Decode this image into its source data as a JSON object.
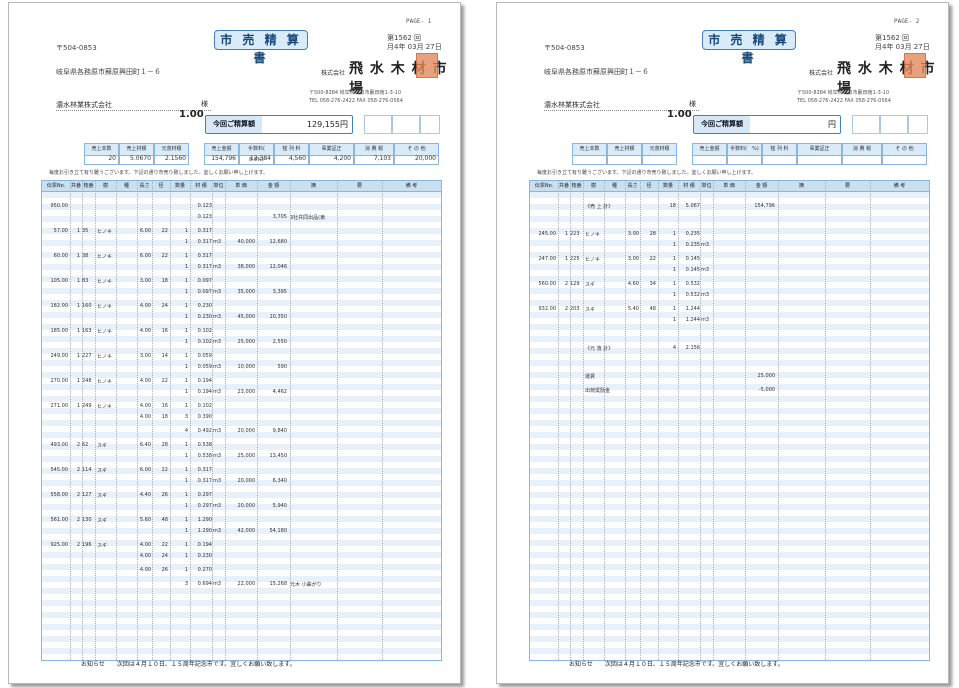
{
  "pages": [
    {
      "page_label": "PAGE- 1",
      "title": "市 売 精 算 書",
      "issue_no": "第1562 回",
      "issue_date": "月4年 03月 27日",
      "postal": "〒504-0853",
      "address": "岐阜県各務原市蘇原興田町１－６",
      "customer": "濃水林業株式会社",
      "honorific": "様",
      "big_number": "1.00",
      "company_prefix": "株式会社",
      "company_name": "飛 水 木 材 市 場",
      "company_addr1": "〒500-8384 岐阜県岐阜市藪田南1-3-10",
      "company_addr2": "TEL 058-276-2422   FAX 058-276-0564",
      "payment_label": "今回ご精算額",
      "payment_value": "129,155円",
      "summary_headers": [
        "売上本数",
        "売上材積",
        "元落材積",
        "売上金額",
        "手数料(　8.0%)",
        "椪 列 料",
        "事業証正",
        "消 費 税",
        "そ の 他"
      ],
      "summary_values": [
        "20",
        "5.0670",
        "2.1560",
        "154,796",
        "12,384",
        "4,560",
        "4,200",
        "7,103",
        "20,000"
      ],
      "notice": "毎度お引き立て有り難うございます。下記の通り市売り致しました。宜しくお願い申し上げます。",
      "table_headers": [
        "伝票No.",
        "共番",
        "枝番",
        "樹",
        "種",
        "長さ",
        "径",
        "数量",
        "材 積",
        "単位",
        "単 価",
        "金 額",
        "摘",
        "要",
        "備 考"
      ],
      "rows": [
        {
          "a": "950.00",
          "b": "",
          "c": "",
          "d": "",
          "e": "",
          "f": "",
          "g": "",
          "h": "",
          "i": "0.123",
          "j": "",
          "k": "",
          "l": "",
          "m": ""
        },
        {
          "a": "",
          "b": "",
          "c": "",
          "d": "",
          "e": "",
          "f": "",
          "g": "",
          "h": "",
          "i": "0.123",
          "j": "",
          "k": "",
          "l": "3,705",
          "m": "3社共同出品(東"
        },
        {
          "a": "57.00",
          "b": "1",
          "c": "35",
          "d": "ヒノキ",
          "e": "6.00",
          "f": "22",
          "g": "1",
          "h": "",
          "i": "0.317",
          "j": "",
          "k": "",
          "l": "",
          "m": ""
        },
        {
          "a": "",
          "b": "",
          "c": "",
          "d": "",
          "e": "",
          "f": "",
          "g": "1",
          "h": "",
          "i": "0.317",
          "j": "m3",
          "k": "40,000",
          "l": "12,680",
          "m": ""
        },
        {
          "a": "60.00",
          "b": "1",
          "c": "38",
          "d": "ヒノキ",
          "e": "6.00",
          "f": "22",
          "g": "1",
          "h": "",
          "i": "0.317",
          "j": "",
          "k": "",
          "l": "",
          "m": ""
        },
        {
          "a": "",
          "b": "",
          "c": "",
          "d": "",
          "e": "",
          "f": "",
          "g": "1",
          "h": "",
          "i": "0.317",
          "j": "m3",
          "k": "38,000",
          "l": "12,046",
          "m": ""
        },
        {
          "a": "105.00",
          "b": "1",
          "c": "83",
          "d": "ヒノキ",
          "e": "3.00",
          "f": "18",
          "g": "1",
          "h": "",
          "i": "0.097",
          "j": "",
          "k": "",
          "l": "",
          "m": ""
        },
        {
          "a": "",
          "b": "",
          "c": "",
          "d": "",
          "e": "",
          "f": "",
          "g": "1",
          "h": "",
          "i": "0.097",
          "j": "m3",
          "k": "35,000",
          "l": "3,395",
          "m": ""
        },
        {
          "a": "182.00",
          "b": "1",
          "c": "160",
          "d": "ヒノキ",
          "e": "4.00",
          "f": "24",
          "g": "1",
          "h": "",
          "i": "0.230",
          "j": "",
          "k": "",
          "l": "",
          "m": ""
        },
        {
          "a": "",
          "b": "",
          "c": "",
          "d": "",
          "e": "",
          "f": "",
          "g": "1",
          "h": "",
          "i": "0.230",
          "j": "m3",
          "k": "45,000",
          "l": "10,350",
          "m": ""
        },
        {
          "a": "185.00",
          "b": "1",
          "c": "163",
          "d": "ヒノキ",
          "e": "4.00",
          "f": "16",
          "g": "1",
          "h": "",
          "i": "0.102",
          "j": "",
          "k": "",
          "l": "",
          "m": ""
        },
        {
          "a": "",
          "b": "",
          "c": "",
          "d": "",
          "e": "",
          "f": "",
          "g": "1",
          "h": "",
          "i": "0.102",
          "j": "m3",
          "k": "25,000",
          "l": "2,550",
          "m": ""
        },
        {
          "a": "249.00",
          "b": "1",
          "c": "227",
          "d": "ヒノキ",
          "e": "3.00",
          "f": "14",
          "g": "1",
          "h": "",
          "i": "0.059",
          "j": "",
          "k": "",
          "l": "",
          "m": ""
        },
        {
          "a": "",
          "b": "",
          "c": "",
          "d": "",
          "e": "",
          "f": "",
          "g": "1",
          "h": "",
          "i": "0.059",
          "j": "m3",
          "k": "10,000",
          "l": "590",
          "m": ""
        },
        {
          "a": "270.00",
          "b": "1",
          "c": "248",
          "d": "ヒノキ",
          "e": "4.00",
          "f": "22",
          "g": "1",
          "h": "",
          "i": "0.194",
          "j": "",
          "k": "",
          "l": "",
          "m": ""
        },
        {
          "a": "",
          "b": "",
          "c": "",
          "d": "",
          "e": "",
          "f": "",
          "g": "1",
          "h": "",
          "i": "0.194",
          "j": "m3",
          "k": "23,000",
          "l": "4,462",
          "m": ""
        },
        {
          "a": "271.00",
          "b": "1",
          "c": "249",
          "d": "ヒノキ",
          "e": "4.00",
          "f": "16",
          "g": "1",
          "h": "",
          "i": "0.102",
          "j": "",
          "k": "",
          "l": "",
          "m": ""
        },
        {
          "a": "",
          "b": "",
          "c": "",
          "d": "",
          "e": "4.00",
          "f": "18",
          "g": "3",
          "h": "",
          "i": "0.390",
          "j": "",
          "k": "",
          "l": "",
          "m": ""
        },
        {
          "a": "",
          "b": "",
          "c": "",
          "d": "",
          "e": "",
          "f": "",
          "g": "4",
          "h": "",
          "i": "0.492",
          "j": "m3",
          "k": "20,000",
          "l": "9,840",
          "m": ""
        },
        {
          "a": "493.00",
          "b": "2",
          "c": "62",
          "d": "スギ",
          "e": "6.40",
          "f": "28",
          "g": "1",
          "h": "",
          "i": "0.538",
          "j": "",
          "k": "",
          "l": "",
          "m": ""
        },
        {
          "a": "",
          "b": "",
          "c": "",
          "d": "",
          "e": "",
          "f": "",
          "g": "1",
          "h": "",
          "i": "0.538",
          "j": "m3",
          "k": "25,000",
          "l": "13,450",
          "m": ""
        },
        {
          "a": "545.00",
          "b": "2",
          "c": "114",
          "d": "スギ",
          "e": "6.00",
          "f": "22",
          "g": "1",
          "h": "",
          "i": "0.317",
          "j": "",
          "k": "",
          "l": "",
          "m": ""
        },
        {
          "a": "",
          "b": "",
          "c": "",
          "d": "",
          "e": "",
          "f": "",
          "g": "1",
          "h": "",
          "i": "0.317",
          "j": "m3",
          "k": "20,000",
          "l": "6,340",
          "m": ""
        },
        {
          "a": "558.00",
          "b": "2",
          "c": "127",
          "d": "スギ",
          "e": "4.40",
          "f": "26",
          "g": "1",
          "h": "",
          "i": "0.297",
          "j": "",
          "k": "",
          "l": "",
          "m": ""
        },
        {
          "a": "",
          "b": "",
          "c": "",
          "d": "",
          "e": "",
          "f": "",
          "g": "1",
          "h": "",
          "i": "0.297",
          "j": "m3",
          "k": "20,000",
          "l": "5,940",
          "m": ""
        },
        {
          "a": "561.00",
          "b": "2",
          "c": "130",
          "d": "スギ",
          "e": "5.60",
          "f": "48",
          "g": "1",
          "h": "",
          "i": "1.290",
          "j": "",
          "k": "",
          "l": "",
          "m": ""
        },
        {
          "a": "",
          "b": "",
          "c": "",
          "d": "",
          "e": "",
          "f": "",
          "g": "1",
          "h": "",
          "i": "1.290",
          "j": "m3",
          "k": "42,000",
          "l": "54,180",
          "m": ""
        },
        {
          "a": "925.00",
          "b": "2",
          "c": "196",
          "d": "スギ",
          "e": "4.00",
          "f": "22",
          "g": "1",
          "h": "",
          "i": "0.194",
          "j": "",
          "k": "",
          "l": "",
          "m": ""
        },
        {
          "a": "",
          "b": "",
          "c": "",
          "d": "",
          "e": "4.00",
          "f": "24",
          "g": "1",
          "h": "",
          "i": "0.230",
          "j": "",
          "k": "",
          "l": "",
          "m": ""
        },
        {
          "a": "",
          "b": "",
          "c": "",
          "d": "",
          "e": "4.00",
          "f": "26",
          "g": "1",
          "h": "",
          "i": "0.270",
          "j": "",
          "k": "",
          "l": "",
          "m": ""
        },
        {
          "a": "",
          "b": "",
          "c": "",
          "d": "",
          "e": "",
          "f": "",
          "g": "3",
          "h": "",
          "i": "0.694",
          "j": "m3",
          "k": "22,000",
          "l": "15,268",
          "m": "元木 小曲がり"
        }
      ],
      "footer": "お知らせ　　次回は４月１０日、１５周年記念市です。宜しくお願い致します。"
    },
    {
      "page_label": "PAGE- 2",
      "title": "市 売 精 算 書",
      "issue_no": "第1562 回",
      "issue_date": "月4年 03月 27日",
      "postal": "〒504-0853",
      "address": "岐阜県各務原市蘇原興田町１－６",
      "customer": "濃水林業株式会社",
      "honorific": "様",
      "big_number": "1.00",
      "company_prefix": "株式会社",
      "company_name": "飛 水 木 材 市 場",
      "company_addr1": "〒500-8384 岐阜県岐阜市藪田南1-3-10",
      "company_addr2": "TEL 058-276-2422   FAX 058-276-0564",
      "payment_label": "今回ご精算額",
      "payment_value": "円",
      "summary_headers": [
        "売上本数",
        "売上材積",
        "元落材積",
        "売上金額",
        "手数料(　%)",
        "椪 列 料",
        "事業証正",
        "消 費 税",
        "そ の 他"
      ],
      "summary_values": [
        "",
        "",
        "",
        "",
        "",
        "",
        "",
        "",
        ""
      ],
      "notice": "毎度お引き立て有り難うございます。下記の通り市売り致しました。宜しくお願い申し上げます。",
      "table_headers": [
        "伝票No.",
        "共番",
        "枝番",
        "樹",
        "種",
        "長さ",
        "径",
        "数量",
        "材 積",
        "単位",
        "単 価",
        "金 額",
        "摘",
        "要",
        "備 考"
      ],
      "rows": [
        {
          "a": "",
          "b": "",
          "c": "",
          "d": "《売 上 計》",
          "e": "",
          "f": "",
          "g": "18",
          "h": "",
          "i": "5.067",
          "j": "",
          "k": "",
          "l": "154,796",
          "m": ""
        },
        {
          "a": "",
          "b": "",
          "c": "",
          "d": "",
          "e": "",
          "f": "",
          "g": "",
          "h": "",
          "i": "",
          "j": "",
          "k": "",
          "l": "",
          "m": ""
        },
        {
          "a": "245.00",
          "b": "1",
          "c": "223",
          "d": "ヒノキ",
          "e": "3.00",
          "f": "28",
          "g": "1",
          "h": "",
          "i": "0.235",
          "j": "",
          "k": "",
          "l": "",
          "m": ""
        },
        {
          "a": "",
          "b": "",
          "c": "",
          "d": "",
          "e": "",
          "f": "",
          "g": "1",
          "h": "",
          "i": "0.235",
          "j": "m3",
          "k": "",
          "l": "",
          "m": ""
        },
        {
          "a": "247.00",
          "b": "1",
          "c": "225",
          "d": "ヒノキ",
          "e": "3.00",
          "f": "22",
          "g": "1",
          "h": "",
          "i": "0.145",
          "j": "",
          "k": "",
          "l": "",
          "m": ""
        },
        {
          "a": "",
          "b": "",
          "c": "",
          "d": "",
          "e": "",
          "f": "",
          "g": "1",
          "h": "",
          "i": "0.145",
          "j": "m3",
          "k": "",
          "l": "",
          "m": ""
        },
        {
          "a": "560.00",
          "b": "2",
          "c": "129",
          "d": "スギ",
          "e": "4.60",
          "f": "34",
          "g": "1",
          "h": "",
          "i": "0.532",
          "j": "",
          "k": "",
          "l": "",
          "m": ""
        },
        {
          "a": "",
          "b": "",
          "c": "",
          "d": "",
          "e": "",
          "f": "",
          "g": "1",
          "h": "",
          "i": "0.532",
          "j": "m3",
          "k": "",
          "l": "",
          "m": ""
        },
        {
          "a": "932.00",
          "b": "2",
          "c": "203",
          "d": "スギ",
          "e": "5.40",
          "f": "48",
          "g": "1",
          "h": "",
          "i": "1.244",
          "j": "",
          "k": "",
          "l": "",
          "m": ""
        },
        {
          "a": "",
          "b": "",
          "c": "",
          "d": "",
          "e": "",
          "f": "",
          "g": "1",
          "h": "",
          "i": "1.244",
          "j": "m3",
          "k": "",
          "l": "",
          "m": ""
        },
        {
          "a": "",
          "b": "",
          "c": "",
          "d": "",
          "e": "",
          "f": "",
          "g": "",
          "h": "",
          "i": "",
          "j": "",
          "k": "",
          "l": "",
          "m": ""
        },
        {
          "a": "",
          "b": "",
          "c": "",
          "d": "《元 落 計》",
          "e": "",
          "f": "",
          "g": "4",
          "h": "",
          "i": "2.156",
          "j": "",
          "k": "",
          "l": "",
          "m": ""
        },
        {
          "a": "",
          "b": "",
          "c": "",
          "d": "",
          "e": "",
          "f": "",
          "g": "",
          "h": "",
          "i": "",
          "j": "",
          "k": "",
          "l": "",
          "m": ""
        },
        {
          "a": "",
          "b": "",
          "c": "",
          "d": "運賃",
          "e": "",
          "f": "",
          "g": "",
          "h": "",
          "i": "",
          "j": "",
          "k": "",
          "l": "25,000",
          "m": ""
        },
        {
          "a": "",
          "b": "",
          "c": "",
          "d": "出荷奨励金",
          "e": "",
          "f": "",
          "g": "",
          "h": "",
          "i": "",
          "j": "",
          "k": "",
          "l": "-5,000",
          "m": ""
        }
      ],
      "footer": "お知らせ　　次回は４月１０日、１５周年記念市です。宜しくお願い致します。"
    }
  ]
}
